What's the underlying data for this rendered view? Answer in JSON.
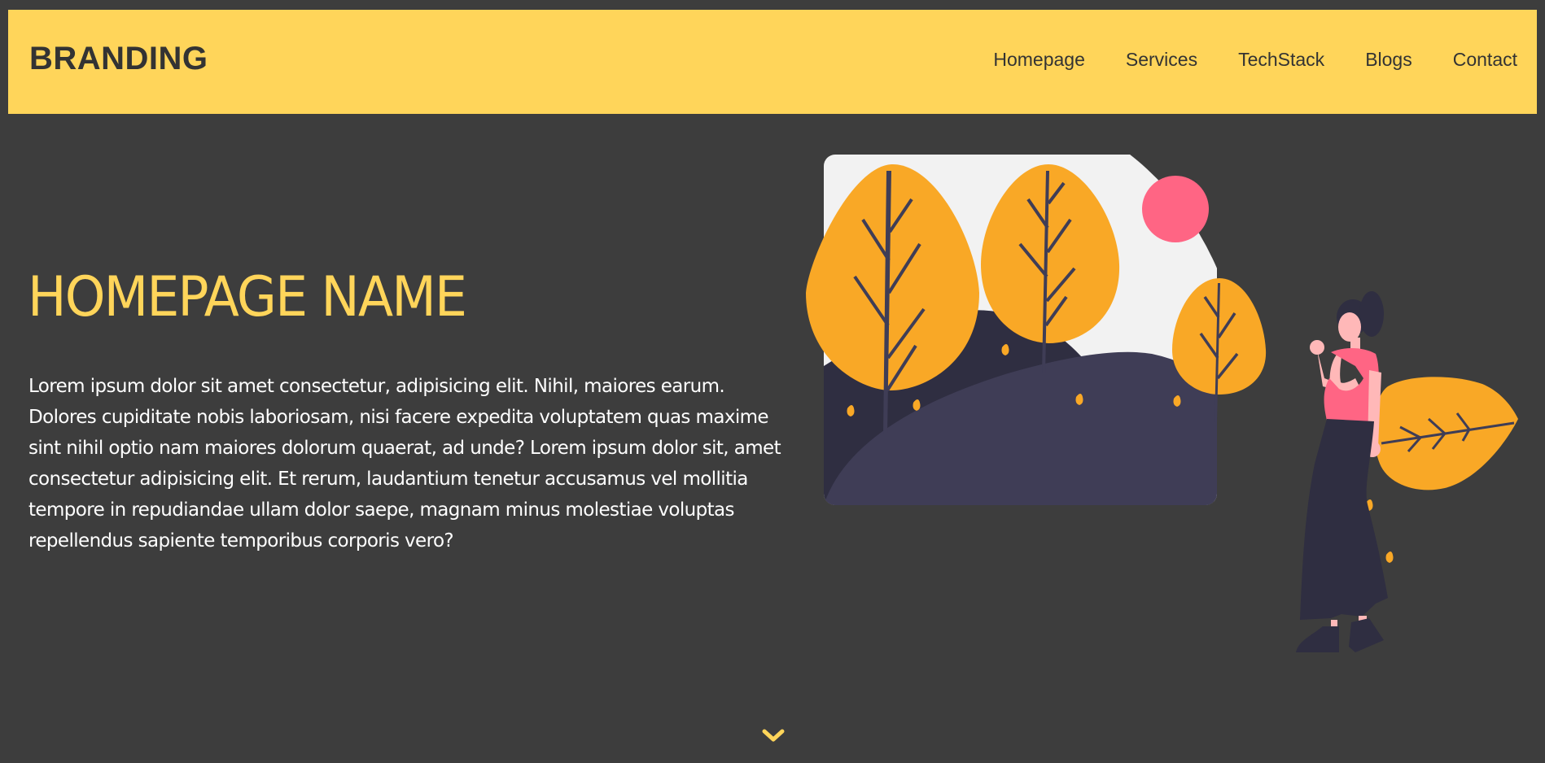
{
  "navbar": {
    "brand": "BRANDING",
    "links": [
      "Homepage",
      "Services",
      "TechStack",
      "Blogs",
      "Contact"
    ]
  },
  "hero": {
    "title": "HOMEPAGE NAME",
    "text": "Lorem ipsum dolor sit amet consectetur, adipisicing elit. Nihil, maiores earum. Dolores cupiditate nobis laboriosam, nisi facere expedita voluptatem quas maxime sint nihil optio nam maiores dolorum quaerat, ad unde? Lorem ipsum dolor sit, amet consectetur adipisicing elit. Et rerum, laudantium tenetur accusamus vel mollitia tempore in repudiandae ullam dolor saepe, magnam minus molestiae voluptas repellendus sapiente temporibus corporis vero?"
  },
  "scroll": {
    "icon": "chevron-down-icon"
  },
  "colors": {
    "background": "#3d3d3d",
    "navbar": "#ffd55a",
    "accent": "#ffd55a",
    "tree": "#f9a826",
    "hill_dark": "#2f2e41",
    "hill": "#3f3d56",
    "sun": "#ff6584",
    "sky": "#f2f2f2"
  }
}
